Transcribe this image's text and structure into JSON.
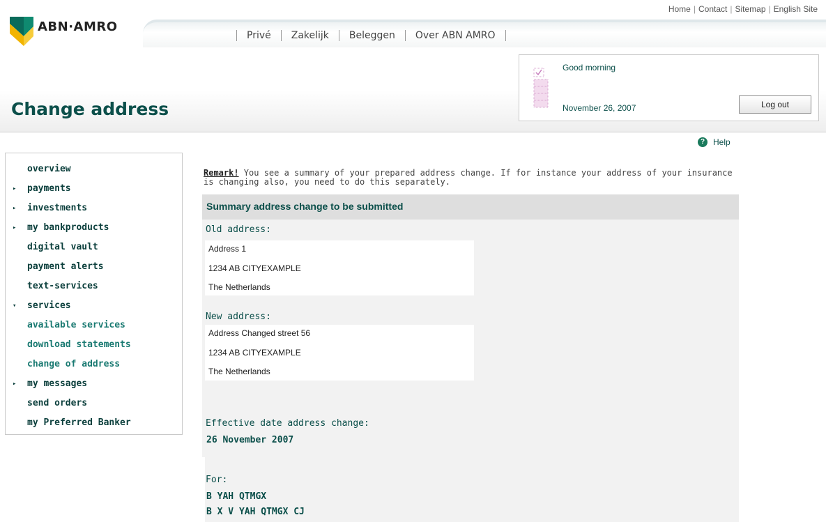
{
  "top_links": [
    "Home",
    "Contact",
    "Sitemap",
    "English Site"
  ],
  "logo": {
    "text": "ABN·AMRO"
  },
  "nav": [
    "Privé",
    "Zakelijk",
    "Beleggen",
    "Over ABN AMRO"
  ],
  "page_title": "Change address",
  "greeting": {
    "hello": "Good morning",
    "date": "November 26, 2007",
    "logout_label": "Log out"
  },
  "help_label": "Help",
  "sidebar": {
    "items": [
      {
        "label": "overview",
        "arrow": ""
      },
      {
        "label": "payments",
        "arrow": "▸"
      },
      {
        "label": "investments",
        "arrow": "▸"
      },
      {
        "label": "my bankproducts",
        "arrow": "▸"
      },
      {
        "label": "digital vault",
        "arrow": ""
      },
      {
        "label": "payment alerts",
        "arrow": ""
      },
      {
        "label": "text-services",
        "arrow": ""
      },
      {
        "label": "services",
        "arrow": "▾"
      },
      {
        "label": "available services",
        "arrow": ""
      },
      {
        "label": "download statements",
        "arrow": ""
      },
      {
        "label": "change of address",
        "arrow": ""
      },
      {
        "label": "my messages",
        "arrow": "▸"
      },
      {
        "label": "send orders",
        "arrow": ""
      },
      {
        "label": "my Preferred Banker",
        "arrow": ""
      }
    ]
  },
  "remark": {
    "label": "Remark!",
    "text": " You see a summary of your prepared address change. If for instance your address of your insurance is changing also, you need to do this separately."
  },
  "summary": {
    "heading": "Summary address change to be submitted",
    "old_label": "Old address:",
    "old_address": [
      "Address 1",
      "1234 AB  CITYEXAMPLE",
      "The Netherlands"
    ],
    "new_label": "New address:",
    "new_address": [
      "Address Changed street 56",
      "1234 AB  CITYEXAMPLE",
      "The Netherlands"
    ],
    "effective_label": "Effective date address change:",
    "effective_date": "26 November 2007",
    "for_label": "For:",
    "for_names": [
      "B YAH QTMGX",
      "B X V YAH QTMGX CJ"
    ]
  },
  "colors": {
    "brand_green": "#0b4f4a",
    "logo_teal": "#0a6b5a",
    "logo_yellow": "#f2b400"
  }
}
